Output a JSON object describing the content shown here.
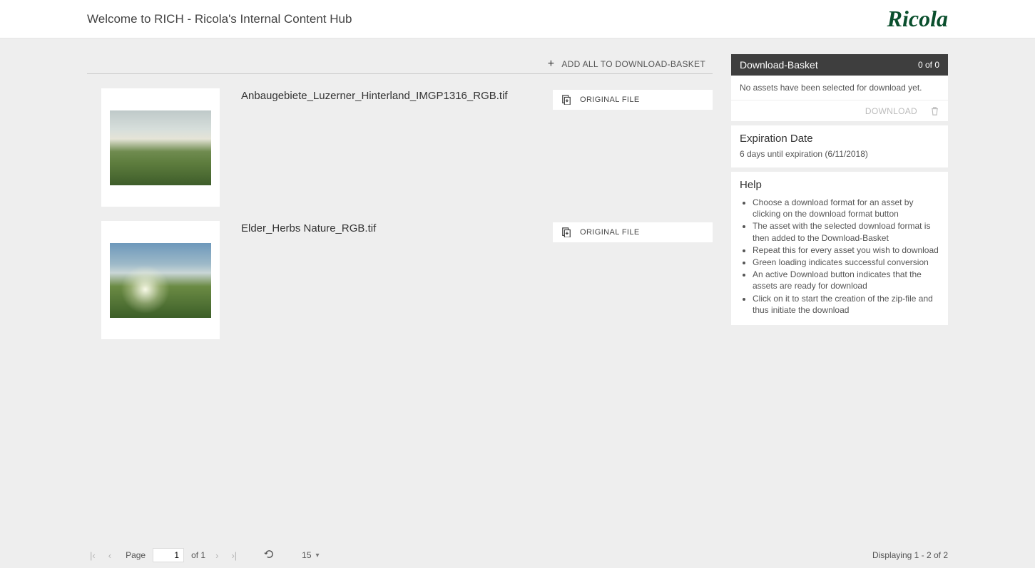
{
  "header": {
    "title": "Welcome to RICH - Ricola's Internal Content Hub",
    "logo_text": "Ricola"
  },
  "toolbar": {
    "add_all_label": "ADD ALL TO DOWNLOAD-BASKET"
  },
  "assets": [
    {
      "title": "Anbaugebiete_Luzerner_Hinterland_IMGP1316_RGB.tif",
      "format_label": "ORIGINAL FILE"
    },
    {
      "title": "Elder_Herbs Nature_RGB.tif",
      "format_label": "ORIGINAL FILE"
    }
  ],
  "basket": {
    "title": "Download-Basket",
    "count_text": "0 of 0",
    "empty_text": "No assets have been selected for download yet.",
    "download_label": "DOWNLOAD"
  },
  "expiration": {
    "title": "Expiration Date",
    "text": "6 days until expiration (6/11/2018)"
  },
  "help": {
    "title": "Help",
    "items": [
      "Choose a download format for an asset by clicking on the download format button",
      "The asset with the selected download format is then added to the Download-Basket",
      "Repeat this for every asset you wish to download",
      "Green loading indicates successful conversion",
      "An active Download button indicates that the assets are ready for download",
      "Click on it to start the creation of the zip-file and thus initiate the download"
    ]
  },
  "paging": {
    "page_label": "Page",
    "current": "1",
    "of_text": "of 1",
    "per_page": "15",
    "status": "Displaying 1 - 2 of 2"
  }
}
